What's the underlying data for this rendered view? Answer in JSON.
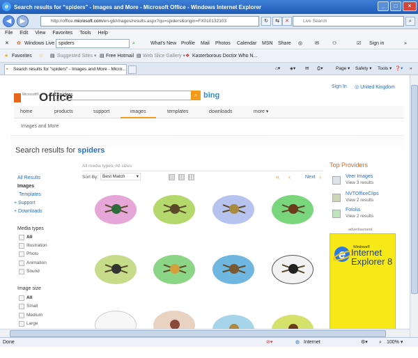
{
  "window": {
    "title": "Search results for \"spiders\" - Images and More - Microsoft Office - Windows Internet Explorer"
  },
  "address": {
    "url_prefix": "http://office.",
    "url_domain": "microsoft.com",
    "url_rest": "/en-gb/images/results.aspx?qu=spiders&origin=FX010132103",
    "search_placeholder": "Live Search"
  },
  "menu": [
    "File",
    "Edit",
    "View",
    "Favorites",
    "Tools",
    "Help"
  ],
  "windows_live": {
    "label": "Windows Live",
    "search_value": "spiders",
    "links": [
      "What's New",
      "Profile",
      "Mail",
      "Photos",
      "Calendar",
      "MSN",
      "Share"
    ],
    "sign_in": "Sign in"
  },
  "favorites": {
    "label": "Favorites",
    "items": [
      "Suggested Sites ▾",
      "Free Hotmail",
      "Web Slice Gallery ▾",
      "Kasterborous Doctor Who N..."
    ]
  },
  "tab": {
    "label": "Search results for \"spiders\" - Images and More - Micro..."
  },
  "commands": [
    "Page ▾",
    "Safety ▾",
    "Tools ▾"
  ],
  "site": {
    "logo": "Office",
    "logo_small": "Microsoft®",
    "search_value": "spiders",
    "bing": "bing",
    "sign_in": "Sign In",
    "region": "United Kingdom",
    "nav": [
      "home",
      "products",
      "support",
      "images",
      "templates",
      "downloads",
      "more ▾"
    ],
    "breadcrumb": "Images and More"
  },
  "results": {
    "title_prefix": "Search results for",
    "query": "spiders",
    "filter_text": "All media types, All sizes",
    "sort_label": "Sort By:",
    "sort_value": "Best Match",
    "next": "Next"
  },
  "left_nav": {
    "all_results": "All Results",
    "images": "Images",
    "templates": "Templates",
    "support": "+ Support",
    "downloads": "+ Downloads",
    "media_types_title": "Media types",
    "media_types": [
      "All",
      "Illustration",
      "Photo",
      "Animation",
      "Sound"
    ],
    "image_size_title": "Image size",
    "image_sizes": [
      "All",
      "Small",
      "Medium",
      "Large"
    ]
  },
  "providers": {
    "title": "Top Providers",
    "items": [
      {
        "name": "Veer Images",
        "sub": "View 3 results"
      },
      {
        "name": "NVTOfficeClips",
        "sub": "View 2 results"
      },
      {
        "name": "Fotolia",
        "sub": "View 2 results"
      }
    ]
  },
  "ad": {
    "label": "advertisement",
    "small": "Windows®",
    "title_line1": "Internet",
    "title_line2": "Explorer 8"
  },
  "status": {
    "left": "Done",
    "zone": "Internet",
    "zoom": "100% ▾"
  },
  "colors": {
    "accent_orange": "#e8641b",
    "link_blue": "#2a6fc0",
    "ad_yellow": "#f7e818"
  }
}
